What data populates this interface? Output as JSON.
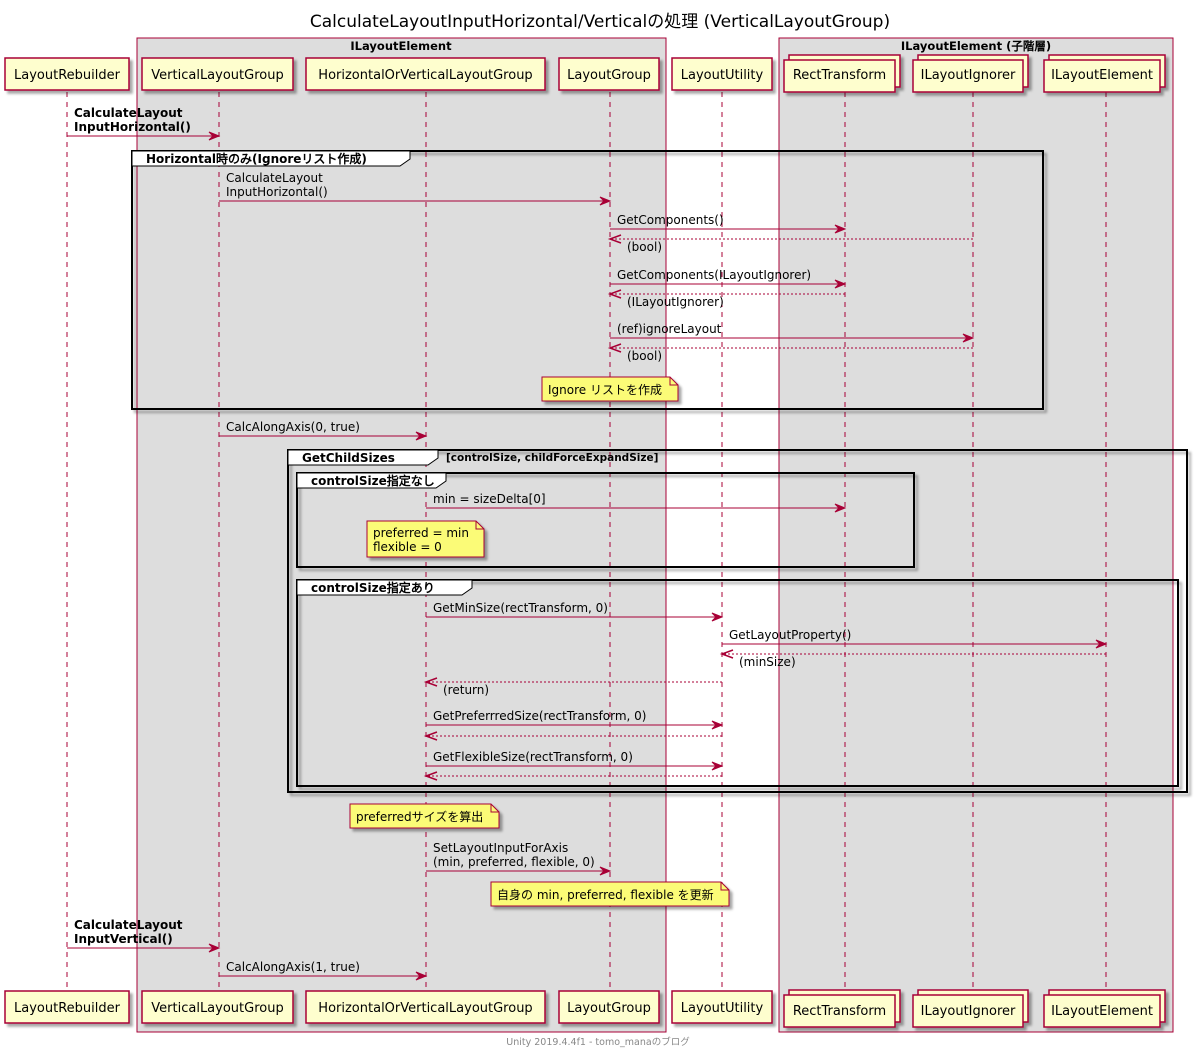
{
  "title": "CalculateLayoutInputHorizontal/Verticalの処理 (VerticalLayoutGroup)",
  "footer": "Unity 2019.4.4f1 - tomo_manaのブログ",
  "colors": {
    "arrow": "#A80036",
    "participant_fill": "#FEFECE",
    "box_fill": "#DDDDDD",
    "note_fill": "#FBFB77"
  },
  "boxes": [
    {
      "id": "ilayout",
      "label": "ILayoutElement"
    },
    {
      "id": "children",
      "label": "ILayoutElement (子階層)"
    }
  ],
  "participants": [
    {
      "id": "rebuilder",
      "label": "LayoutRebuilder"
    },
    {
      "id": "vlg",
      "label": "VerticalLayoutGroup"
    },
    {
      "id": "hovlg",
      "label": "HorizontalOrVerticalLayoutGroup"
    },
    {
      "id": "lg",
      "label": "LayoutGroup"
    },
    {
      "id": "util",
      "label": "LayoutUtility"
    },
    {
      "id": "rect",
      "label": "RectTransform"
    },
    {
      "id": "ignorer",
      "label": "ILayoutIgnorer"
    },
    {
      "id": "element",
      "label": "ILayoutElement"
    }
  ],
  "fragments": [
    {
      "id": "f1",
      "title": "Horizontal時のみ(Ignoreリスト作成)",
      "condition": ""
    },
    {
      "id": "f2",
      "title": "GetChildSizes",
      "condition": "[controlSize, childForceExpandSize]"
    },
    {
      "id": "f3",
      "title": "controlSize指定なし",
      "condition": ""
    },
    {
      "id": "f4",
      "title": "controlSize指定あり",
      "condition": ""
    }
  ],
  "messages": [
    {
      "id": "m1",
      "lines": [
        "CalculateLayout",
        "InputHorizontal()"
      ],
      "bold": true
    },
    {
      "id": "m2",
      "lines": [
        "CalculateLayout",
        "InputHorizontal()"
      ]
    },
    {
      "id": "m3",
      "lines": [
        "GetComponents()"
      ]
    },
    {
      "id": "m4",
      "lines": [
        "(bool)"
      ]
    },
    {
      "id": "m5",
      "lines": [
        "GetComponents(ILayoutIgnorer)"
      ]
    },
    {
      "id": "m6",
      "lines": [
        "(ILayoutIgnorer)"
      ]
    },
    {
      "id": "m7",
      "lines": [
        "(ref)ignoreLayout"
      ]
    },
    {
      "id": "m8",
      "lines": [
        "(bool)"
      ]
    },
    {
      "id": "m9",
      "lines": [
        "CalcAlongAxis(0, true)"
      ]
    },
    {
      "id": "m10",
      "lines": [
        "min = sizeDelta[0]"
      ]
    },
    {
      "id": "m11",
      "lines": [
        "GetMinSize(rectTransform, 0)"
      ]
    },
    {
      "id": "m12",
      "lines": [
        "GetLayoutProperty()"
      ]
    },
    {
      "id": "m13",
      "lines": [
        "(minSize)"
      ]
    },
    {
      "id": "m14",
      "lines": [
        "(return)"
      ]
    },
    {
      "id": "m15",
      "lines": [
        "GetPreferrredSize(rectTransform, 0)"
      ]
    },
    {
      "id": "m16",
      "lines": []
    },
    {
      "id": "m17",
      "lines": [
        "GetFlexibleSize(rectTransform, 0)"
      ]
    },
    {
      "id": "m18",
      "lines": []
    },
    {
      "id": "m19",
      "lines": [
        "SetLayoutInputForAxis",
        "(min, preferred, flexible, 0)"
      ]
    },
    {
      "id": "m20",
      "lines": [
        "CalculateLayout",
        "InputVertical()"
      ],
      "bold": true
    },
    {
      "id": "m21",
      "lines": [
        "CalcAlongAxis(1, true)"
      ]
    }
  ],
  "notes": [
    {
      "id": "n1",
      "lines": [
        "Ignore リストを作成"
      ]
    },
    {
      "id": "n2",
      "lines": [
        "preferred = min",
        "flexible = 0"
      ]
    },
    {
      "id": "n3",
      "lines": [
        "preferredサイズを算出"
      ]
    },
    {
      "id": "n4",
      "lines": [
        "自身の min, preferred, flexible を更新"
      ]
    }
  ]
}
